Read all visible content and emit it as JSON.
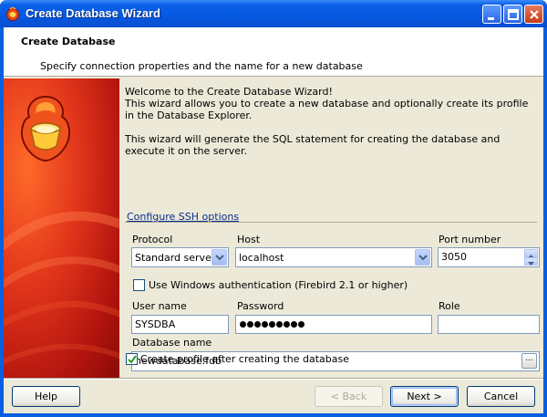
{
  "window": {
    "title": "Create Database Wizard"
  },
  "header": {
    "title": "Create Database",
    "subtitle": "Specify connection properties and the name for a new database"
  },
  "intro": {
    "line1": "Welcome to the Create Database Wizard!",
    "line2": "This wizard allows you to create a new database and optionally create its profile in the Database Explorer.",
    "line3": "This wizard will generate the SQL statement for creating the database and execute it on the server."
  },
  "ssh_link": "Configure SSH options",
  "connection": {
    "protocol_label": "Protocol",
    "protocol_value": "Standard server",
    "host_label": "Host",
    "host_value": "localhost",
    "port_label": "Port number",
    "port_value": "3050",
    "windows_auth_label": "Use Windows authentication (Firebird 2.1 or higher)",
    "windows_auth_checked": false,
    "user_label": "User name",
    "user_value": "SYSDBA",
    "password_label": "Password",
    "password_mask_length": 9,
    "role_label": "Role",
    "role_value": "",
    "dbname_label": "Database name",
    "dbname_value": "newdatabase.fdb",
    "browse_label": "...",
    "create_profile_label": "Create profile after creating the database",
    "create_profile_checked": true
  },
  "buttons": {
    "help": "Help",
    "back": "< Back",
    "next": "Next >",
    "cancel": "Cancel"
  },
  "colors": {
    "titlebar": "#0a5ee8",
    "banner": "#d42a14",
    "link": "#0a2d8c",
    "checkmark": "#21a121"
  }
}
